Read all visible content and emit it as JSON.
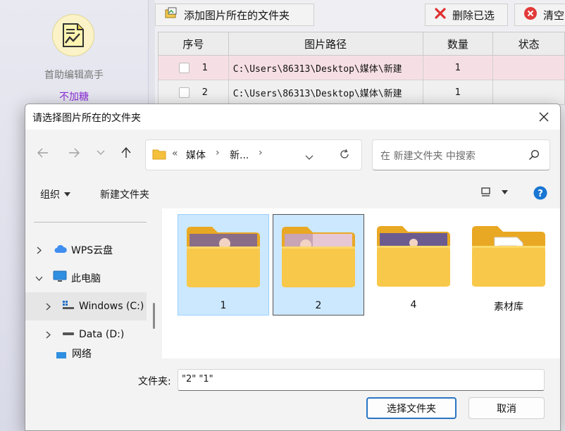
{
  "app": {
    "name": "首助编辑高手",
    "subtitle": "不加糖"
  },
  "toolbar": {
    "add_folder": "添加图片所在的文件夹",
    "delete_selected": "删除已选",
    "clear": "清空"
  },
  "table": {
    "headers": [
      "序号",
      "图片路径",
      "数量",
      "状态"
    ],
    "rows": [
      {
        "index": "1",
        "path": "C:\\Users\\86313\\Desktop\\媒体\\新建",
        "count": "1",
        "status": ""
      },
      {
        "index": "2",
        "path": "C:\\Users\\86313\\Desktop\\媒体\\新建",
        "count": "1",
        "status": ""
      }
    ]
  },
  "dialog": {
    "title": "请选择图片所在的文件夹",
    "breadcrumb": {
      "prefix": "«",
      "items": [
        "媒体",
        "新..."
      ]
    },
    "search_placeholder": "在 新建文件夹 中搜索",
    "organize": "组织",
    "new_folder": "新建文件夹",
    "nav": {
      "items": [
        {
          "label": "WPS云盘",
          "icon": "cloud-icon"
        },
        {
          "label": "此电脑",
          "icon": "monitor-icon"
        },
        {
          "label": "Windows (C:)",
          "icon": "drive-c-icon"
        },
        {
          "label": "Data (D:)",
          "icon": "drive-icon"
        },
        {
          "label": "网络",
          "icon": "network-icon"
        }
      ]
    },
    "folders": [
      {
        "label": "1",
        "thumbnail": "pink-dress-illustration"
      },
      {
        "label": "2",
        "thumbnail": "pink-dress-illustration"
      },
      {
        "label": "4",
        "thumbnail": "purple-dress-illustration"
      },
      {
        "label": "素材库",
        "thumbnail": "document-icon"
      }
    ],
    "filename_label": "文件夹:",
    "filename_value": "\"2\" \"1\"",
    "select_button": "选择文件夹",
    "cancel_button": "取消"
  },
  "colors": {
    "accent": "#2a74c5",
    "selection": "#cce8ff",
    "row_highlight": "#f6dfe4",
    "brand_purple": "#8a2cd6",
    "folder_yellow": "#f6c343"
  }
}
